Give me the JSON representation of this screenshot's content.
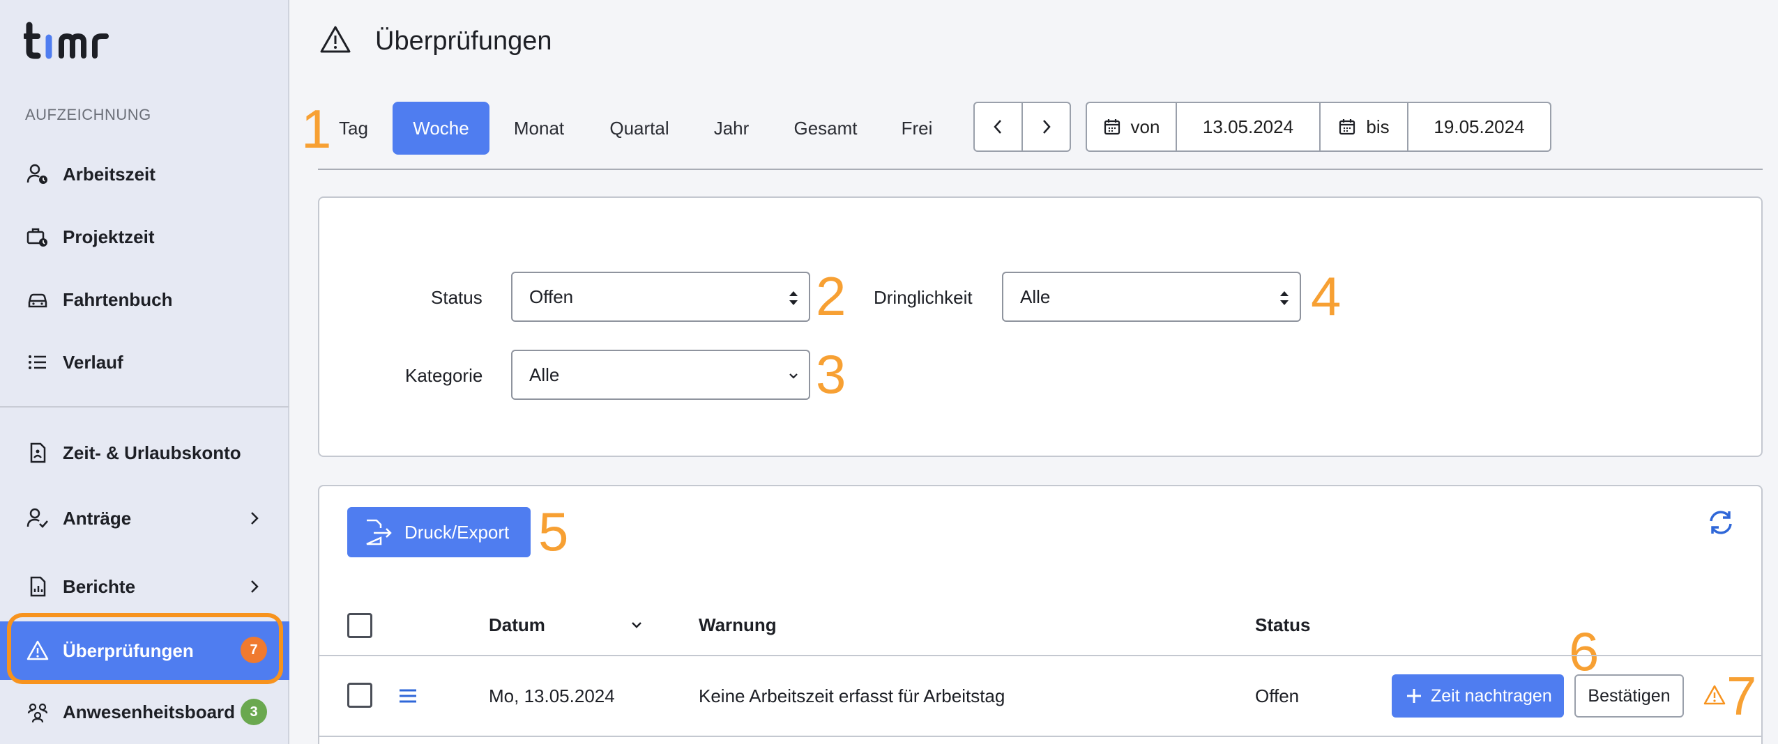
{
  "app": {
    "logo_text": "timr"
  },
  "sidebar": {
    "section_title": "AUFZEICHNUNG",
    "items": [
      {
        "label": "Arbeitszeit",
        "icon": "user-clock-icon"
      },
      {
        "label": "Projektzeit",
        "icon": "briefcase-clock-icon"
      },
      {
        "label": "Fahrtenbuch",
        "icon": "car-icon"
      },
      {
        "label": "Verlauf",
        "icon": "list-icon"
      },
      {
        "label": "Zeit- & Urlaubskonto",
        "icon": "document-icon"
      },
      {
        "label": "Anträge",
        "icon": "user-check-icon",
        "has_submenu": true
      },
      {
        "label": "Berichte",
        "icon": "report-icon",
        "has_submenu": true
      },
      {
        "label": "Überprüfungen",
        "icon": "warning-icon",
        "badge": "7",
        "active": true
      },
      {
        "label": "Anwesenheitsboard",
        "icon": "group-icon",
        "badge": "3"
      }
    ]
  },
  "header": {
    "title": "Überprüfungen",
    "icon": "warning-icon"
  },
  "period": {
    "tabs": [
      "Tag",
      "Woche",
      "Monat",
      "Quartal",
      "Jahr",
      "Gesamt",
      "Frei"
    ],
    "active": "Woche",
    "from_label": "von",
    "from_value": "13.05.2024",
    "to_label": "bis",
    "to_value": "19.05.2024"
  },
  "filters": {
    "status_label": "Status",
    "status_value": "Offen",
    "urgency_label": "Dringlichkeit",
    "urgency_value": "Alle",
    "category_label": "Kategorie",
    "category_value": "Alle"
  },
  "toolbar": {
    "export_label": "Druck/Export"
  },
  "table": {
    "columns": [
      "Datum",
      "Warnung",
      "Status"
    ],
    "rows": [
      {
        "date": "Mo, 13.05.2024",
        "warning": "Keine Arbeitszeit erfasst für Arbeitstag",
        "status": "Offen",
        "add_time_label": "Zeit nachtragen",
        "confirm_label": "Bestätigen"
      }
    ]
  },
  "annotations": [
    "1",
    "2",
    "3",
    "4",
    "5",
    "6",
    "7"
  ],
  "colors": {
    "accent": "#4f7df0",
    "annotation": "#f7a033",
    "badge_orange": "#f07a2f",
    "badge_green": "#6aa84f"
  }
}
